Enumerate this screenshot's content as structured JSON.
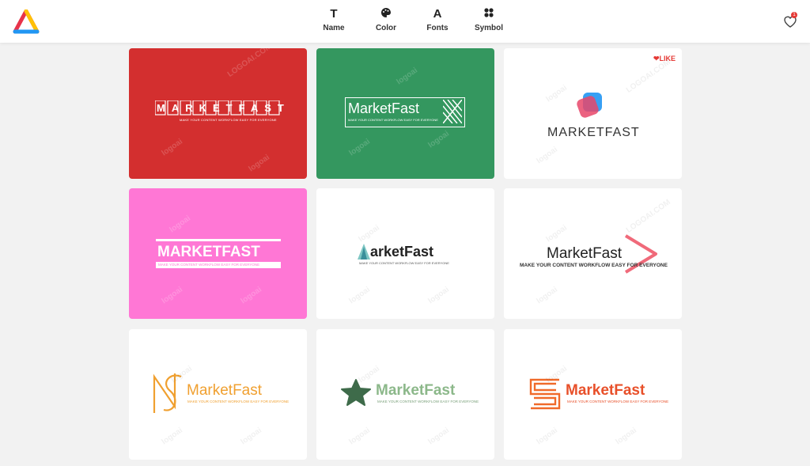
{
  "header": {
    "nav": [
      {
        "label": "Name",
        "glyph": "T",
        "icon": "text-icon"
      },
      {
        "label": "Color",
        "glyph": "",
        "icon": "palette-icon"
      },
      {
        "label": "Fonts",
        "glyph": "A",
        "icon": "font-icon"
      },
      {
        "label": "Symbol",
        "glyph": "",
        "icon": "symbol-icon"
      }
    ],
    "favorites_count": "1",
    "colors": {
      "logo_red": "#e8334a",
      "logo_yellow": "#ffc107",
      "logo_blue": "#2196f3",
      "badge": "#e53935"
    }
  },
  "watermark": {
    "brand": "logoai",
    "domain": "LOGOAI.COM"
  },
  "cards": [
    {
      "bg": "#d32f2f",
      "name": "MARKETFAST",
      "tagline": "MAKE YOUR CONTENT WORKFLOW EASY FOR EVERYONE"
    },
    {
      "bg": "#34975f",
      "name": "MarketFast",
      "tagline": "MAKE YOUR CONTENT WORKFLOW EASY FOR EVERYONE"
    },
    {
      "bg": "#ffffff",
      "name": "MARKETFAST",
      "like_label": "LIKE"
    },
    {
      "bg": "#ff77d5",
      "name": "MARKETFAST",
      "tagline": "MAKE YOUR CONTENT WORKFLOW EASY FOR EVERYONE"
    },
    {
      "bg": "#ffffff",
      "name": "arketFast",
      "tagline": "MAKE YOUR CONTENT WORKFLOW EASY FOR EVERYONE"
    },
    {
      "bg": "#ffffff",
      "name": "MarketFast",
      "tagline": "MAKE YOUR CONTENT WORKFLOW EASY FOR EVERYONE"
    },
    {
      "bg": "#ffffff",
      "name": "MarketFast",
      "tagline": "MAKE YOUR CONTENT WORKFLOW EASY FOR EVERYONE"
    },
    {
      "bg": "#ffffff",
      "name": "MarketFast",
      "tagline": "MAKE YOUR CONTENT WORKFLOW EASY FOR EVERYONE"
    },
    {
      "bg": "#ffffff",
      "name": "MarketFast",
      "tagline": "MAKE YOUR CONTENT WORKFLOW EASY FOR EVERYONE"
    }
  ]
}
